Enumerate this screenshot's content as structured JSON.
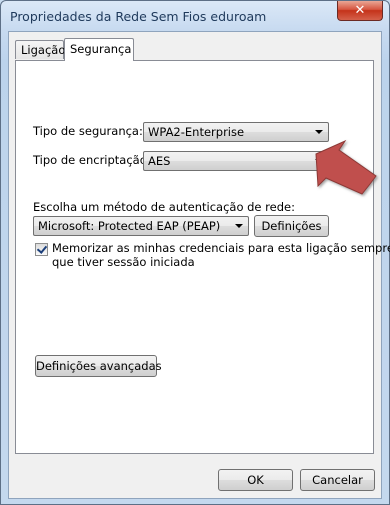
{
  "window": {
    "title": "Propriedades da Rede Sem Fios eduroam",
    "close_label": "✕"
  },
  "tabs": [
    {
      "label": "Ligação",
      "active": false
    },
    {
      "label": "Segurança",
      "active": true
    }
  ],
  "security": {
    "type_label": "Tipo de segurança:",
    "type_value": "WPA2-Enterprise",
    "encryption_label": "Tipo de encriptação:",
    "encryption_value": "AES"
  },
  "auth": {
    "method_label": "Escolha um método de autenticação de rede:",
    "method_value": "Microsoft: Protected EAP (PEAP)",
    "settings_button": "Definições",
    "remember_checked": true,
    "remember_label_line1": "Memorizar as minhas credenciais para esta ligação sempre",
    "remember_label_line2": "que tiver sessão iniciada"
  },
  "advanced_button": "Definições avançadas",
  "footer": {
    "ok_label": "OK",
    "cancel_label": "Cancelar"
  },
  "colors": {
    "arrow": "#c0504d",
    "close_button": "#c4321a",
    "titlebar": "#c7daf0"
  }
}
